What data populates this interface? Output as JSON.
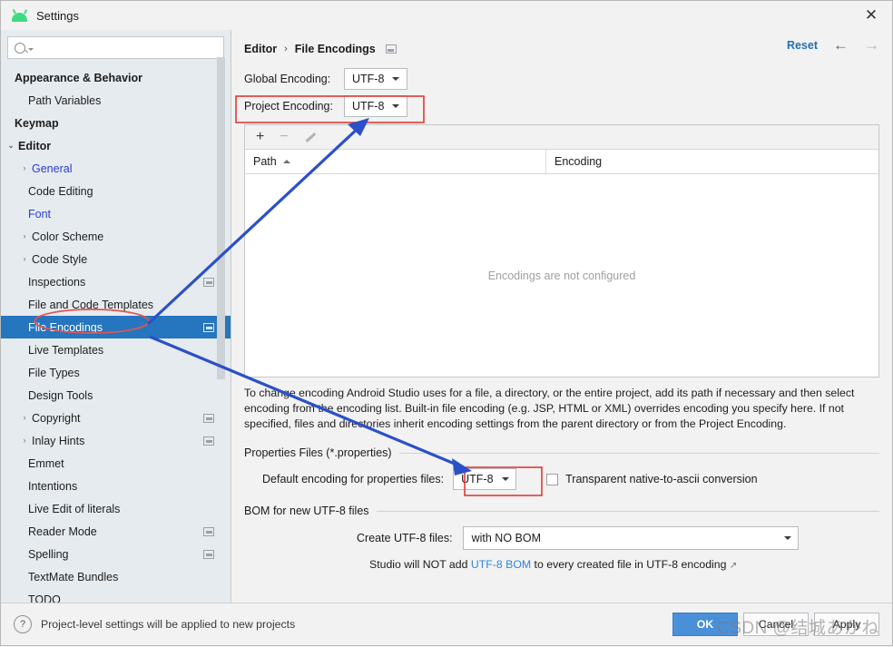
{
  "window": {
    "title": "Settings",
    "close_label": "✕",
    "app_icon": "android-logo-icon"
  },
  "sidebar": {
    "search": {
      "value": "",
      "placeholder": ""
    },
    "items": [
      {
        "label": "Appearance & Behavior",
        "level": 0,
        "bold": true,
        "twisty": "",
        "badge": false,
        "selected": false,
        "link": false
      },
      {
        "label": "Path Variables",
        "level": 1,
        "bold": false,
        "twisty": "",
        "badge": false,
        "selected": false,
        "link": false
      },
      {
        "label": "Keymap",
        "level": 0,
        "bold": true,
        "twisty": "",
        "badge": false,
        "selected": false,
        "link": false
      },
      {
        "label": "Editor",
        "level": 0,
        "bold": true,
        "twisty": "⌄",
        "badge": false,
        "selected": false,
        "link": false
      },
      {
        "label": "General",
        "level": 1,
        "bold": false,
        "twisty": "›",
        "badge": false,
        "selected": false,
        "link": true
      },
      {
        "label": "Code Editing",
        "level": 1,
        "bold": false,
        "twisty": "",
        "badge": false,
        "selected": false,
        "link": false
      },
      {
        "label": "Font",
        "level": 1,
        "bold": false,
        "twisty": "",
        "badge": false,
        "selected": false,
        "link": true
      },
      {
        "label": "Color Scheme",
        "level": 1,
        "bold": false,
        "twisty": "›",
        "badge": false,
        "selected": false,
        "link": false
      },
      {
        "label": "Code Style",
        "level": 1,
        "bold": false,
        "twisty": "›",
        "badge": false,
        "selected": false,
        "link": false
      },
      {
        "label": "Inspections",
        "level": 1,
        "bold": false,
        "twisty": "",
        "badge": true,
        "selected": false,
        "link": false
      },
      {
        "label": "File and Code Templates",
        "level": 1,
        "bold": false,
        "twisty": "",
        "badge": false,
        "selected": false,
        "link": false
      },
      {
        "label": "File Encodings",
        "level": 1,
        "bold": false,
        "twisty": "",
        "badge": true,
        "selected": true,
        "link": false
      },
      {
        "label": "Live Templates",
        "level": 1,
        "bold": false,
        "twisty": "",
        "badge": false,
        "selected": false,
        "link": false
      },
      {
        "label": "File Types",
        "level": 1,
        "bold": false,
        "twisty": "",
        "badge": false,
        "selected": false,
        "link": false
      },
      {
        "label": "Design Tools",
        "level": 1,
        "bold": false,
        "twisty": "",
        "badge": false,
        "selected": false,
        "link": false
      },
      {
        "label": "Copyright",
        "level": 1,
        "bold": false,
        "twisty": "›",
        "badge": true,
        "selected": false,
        "link": false
      },
      {
        "label": "Inlay Hints",
        "level": 1,
        "bold": false,
        "twisty": "›",
        "badge": true,
        "selected": false,
        "link": false
      },
      {
        "label": "Emmet",
        "level": 1,
        "bold": false,
        "twisty": "",
        "badge": false,
        "selected": false,
        "link": false
      },
      {
        "label": "Intentions",
        "level": 1,
        "bold": false,
        "twisty": "",
        "badge": false,
        "selected": false,
        "link": false
      },
      {
        "label": "Live Edit of literals",
        "level": 1,
        "bold": false,
        "twisty": "",
        "badge": false,
        "selected": false,
        "link": false
      },
      {
        "label": "Reader Mode",
        "level": 1,
        "bold": false,
        "twisty": "",
        "badge": true,
        "selected": false,
        "link": false
      },
      {
        "label": "Spelling",
        "level": 1,
        "bold": false,
        "twisty": "",
        "badge": true,
        "selected": false,
        "link": false
      },
      {
        "label": "TextMate Bundles",
        "level": 1,
        "bold": false,
        "twisty": "",
        "badge": false,
        "selected": false,
        "link": false
      },
      {
        "label": "TODO",
        "level": 1,
        "bold": false,
        "twisty": "",
        "badge": false,
        "selected": false,
        "link": false
      }
    ]
  },
  "main": {
    "breadcrumb": {
      "parent": "Editor",
      "separator": "›",
      "current": "File Encodings"
    },
    "reset_label": "Reset",
    "nav_back": "←",
    "nav_forward": "→",
    "global_encoding": {
      "label": "Global Encoding:",
      "value": "UTF-8"
    },
    "project_encoding": {
      "label": "Project Encoding:",
      "value": "UTF-8"
    },
    "table": {
      "toolbar": {
        "add": "+",
        "remove": "−",
        "edit": "pencil-icon"
      },
      "columns": [
        "Path",
        "Encoding"
      ],
      "sort_column": "Path",
      "sort_direction": "ascending",
      "rows": [],
      "empty_text": "Encodings are not configured"
    },
    "help_text": "To change encoding Android Studio uses for a file, a directory, or the entire project, add its path if necessary and then select encoding from the encoding list. Built-in file encoding (e.g. JSP, HTML or XML) overrides encoding you specify here. If not specified, files and directories inherit encoding settings from the parent directory or from the Project Encoding.",
    "properties_group": {
      "title": "Properties Files (*.properties)",
      "default_encoding_label": "Default encoding for properties files:",
      "default_encoding_value": "UTF-8",
      "transparent_label": "Transparent native-to-ascii conversion",
      "transparent_checked": false
    },
    "bom_group": {
      "title": "BOM for new UTF-8 files",
      "create_label": "Create UTF-8 files:",
      "create_value": "with NO BOM",
      "note_prefix": "Studio will NOT add ",
      "note_link": "UTF-8 BOM",
      "note_suffix": " to every created file in UTF-8 encoding",
      "note_ext_icon": "↗"
    }
  },
  "footer": {
    "help_icon": "?",
    "note": "Project-level settings will be applied to new projects",
    "buttons": {
      "ok": "OK",
      "cancel": "Cancel",
      "apply": "Apply"
    }
  },
  "annotations": {
    "watermark": "CSDN @结城あかね",
    "highlight_color": "#e03a32",
    "arrow_color": "#2b50c8",
    "ellipse_color": "#e03a32"
  }
}
